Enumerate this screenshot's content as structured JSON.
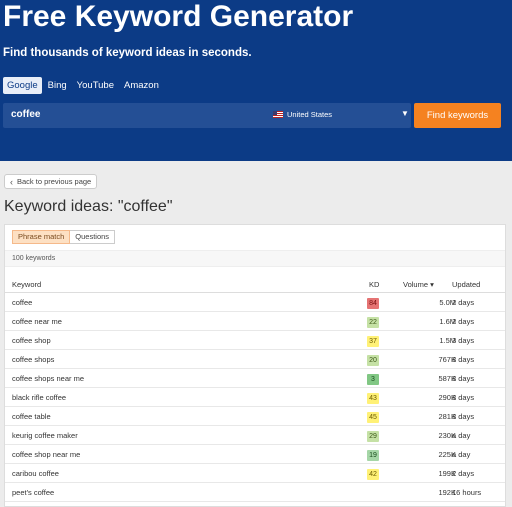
{
  "hero": {
    "title": "Free Keyword Generator",
    "subtitle": "Find thousands of keyword ideas in seconds.",
    "engines": [
      "Google",
      "Bing",
      "YouTube",
      "Amazon"
    ],
    "active_engine": "Google"
  },
  "search": {
    "value": "coffee",
    "country": "United States",
    "country_flag": "us-flag-icon",
    "submit_label": "Find keywords"
  },
  "back_label": "Back to previous page",
  "page_title": "Keyword ideas: \"coffee\"",
  "tabs": [
    "Phrase match",
    "Questions"
  ],
  "active_tab": "Phrase match",
  "count_text": "100 keywords",
  "table": {
    "headers": {
      "keyword": "Keyword",
      "kd": "KD",
      "volume": "Volume",
      "volume_sort": "▾",
      "updated": "Updated"
    },
    "rows": [
      {
        "keyword": "coffee",
        "kd": "84",
        "kd_color": "#e57373",
        "kd_text": "#7a1010",
        "volume": "5.0M",
        "updated": "2 days"
      },
      {
        "keyword": "coffee near me",
        "kd": "22",
        "kd_color": "#c5e1a5",
        "kd_text": "#3e5a1a",
        "volume": "1.6M",
        "updated": "2 days"
      },
      {
        "keyword": "coffee shop",
        "kd": "37",
        "kd_color": "#fff176",
        "kd_text": "#6a5a00",
        "volume": "1.5M",
        "updated": "3 days"
      },
      {
        "keyword": "coffee shops",
        "kd": "20",
        "kd_color": "#c5e1a5",
        "kd_text": "#3e5a1a",
        "volume": "767K",
        "updated": "3 days"
      },
      {
        "keyword": "coffee shops near me",
        "kd": "3",
        "kd_color": "#81c784",
        "kd_text": "#1b4d1e",
        "volume": "587K",
        "updated": "3 days"
      },
      {
        "keyword": "black rifle coffee",
        "kd": "43",
        "kd_color": "#fff176",
        "kd_text": "#6a5a00",
        "volume": "290K",
        "updated": "3 days"
      },
      {
        "keyword": "coffee table",
        "kd": "45",
        "kd_color": "#fff176",
        "kd_text": "#6a5a00",
        "volume": "281K",
        "updated": "3 days"
      },
      {
        "keyword": "keurig coffee maker",
        "kd": "29",
        "kd_color": "#c5e1a5",
        "kd_text": "#3e5a1a",
        "volume": "230K",
        "updated": "a day"
      },
      {
        "keyword": "coffee shop near me",
        "kd": "19",
        "kd_color": "#a5d6a7",
        "kd_text": "#1b4d1e",
        "volume": "225K",
        "updated": "a day"
      },
      {
        "keyword": "caribou coffee",
        "kd": "42",
        "kd_color": "#fff176",
        "kd_text": "#6a5a00",
        "volume": "199K",
        "updated": "2 days"
      },
      {
        "keyword": "peet's coffee",
        "kd": "",
        "kd_color": "",
        "kd_text": "",
        "volume": "192K",
        "updated": "16 hours"
      }
    ]
  }
}
